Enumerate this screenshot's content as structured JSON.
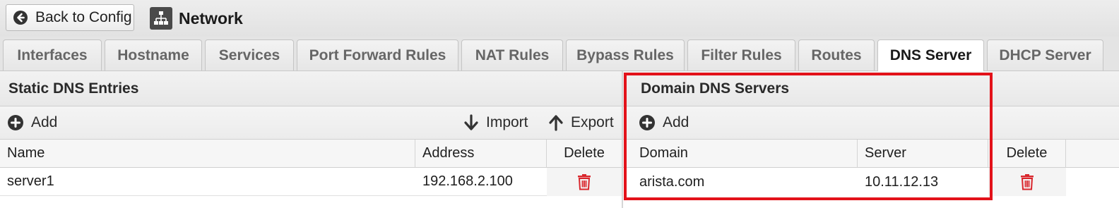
{
  "header": {
    "back_label": "Back to Config",
    "title": "Network",
    "title_icon": "network-icon",
    "back_icon": "circle-arrow-left-icon"
  },
  "tabs": [
    {
      "label": "Interfaces",
      "active": false
    },
    {
      "label": "Hostname",
      "active": false
    },
    {
      "label": "Services",
      "active": false
    },
    {
      "label": "Port Forward Rules",
      "active": false
    },
    {
      "label": "NAT Rules",
      "active": false
    },
    {
      "label": "Bypass Rules",
      "active": false
    },
    {
      "label": "Filter Rules",
      "active": false
    },
    {
      "label": "Routes",
      "active": false
    },
    {
      "label": "DNS Server",
      "active": true
    },
    {
      "label": "DHCP Server",
      "active": false
    }
  ],
  "static_dns": {
    "title": "Static DNS Entries",
    "add_label": "Add",
    "import_label": "Import",
    "export_label": "Export",
    "columns": {
      "name": "Name",
      "address": "Address",
      "delete": "Delete"
    },
    "rows": [
      {
        "name": "server1",
        "address": "192.168.2.100"
      }
    ]
  },
  "domain_dns": {
    "title": "Domain DNS Servers",
    "add_label": "Add",
    "columns": {
      "domain": "Domain",
      "server": "Server",
      "delete": "Delete"
    },
    "rows": [
      {
        "domain": "arista.com",
        "server": "10.11.12.13"
      }
    ]
  },
  "colors": {
    "highlight": "#e3121a",
    "delete_icon": "#d9262c"
  }
}
